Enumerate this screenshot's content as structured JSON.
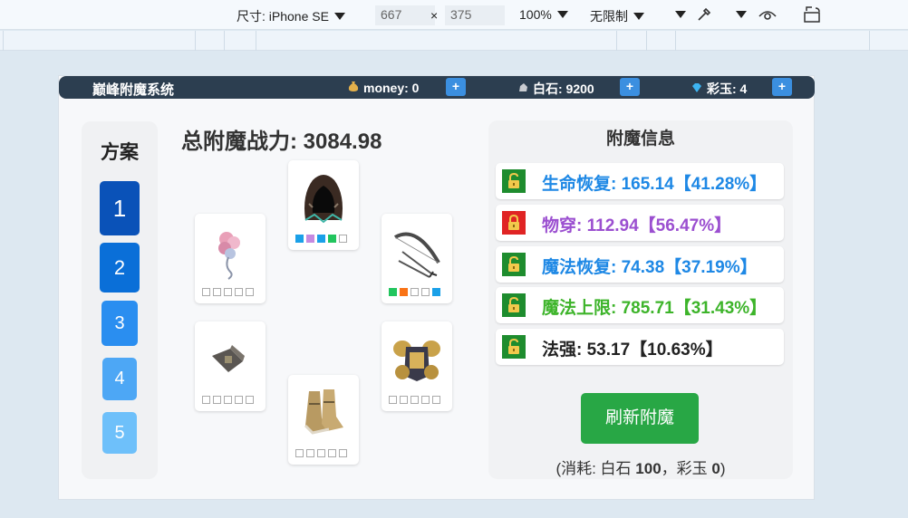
{
  "devtools": {
    "size_label": "尺寸: iPhone SE",
    "width": "667",
    "times": "×",
    "height": "375",
    "zoom": "100%",
    "throttle": "无限制"
  },
  "app": {
    "title": "巅峰附魔系统",
    "money_label": "money: 0",
    "stone_label": "白石: 9200",
    "jade_label": "彩玉: 4",
    "plus": "+"
  },
  "schemes": {
    "title": "方案",
    "items": [
      {
        "label": "1",
        "color": "#0a52b8"
      },
      {
        "label": "2",
        "color": "#0a6fd8"
      },
      {
        "label": "3",
        "color": "#2a8ef0"
      },
      {
        "label": "4",
        "color": "#4da7f5"
      },
      {
        "label": "5",
        "color": "#6ec0fa"
      }
    ]
  },
  "power": "总附魔战力: 3084.98",
  "equipment": {
    "hood": {
      "icon": "hood-icon",
      "gems": [
        "#1aa0e8",
        "#c58ae0",
        "#1aa0e8",
        "#22c55e",
        "#ffffff"
      ]
    },
    "flower": {
      "icon": "flower-icon",
      "gems": [
        "#ffffff",
        "#ffffff",
        "#ffffff",
        "#ffffff",
        "#ffffff"
      ]
    },
    "bow": {
      "icon": "bow-icon",
      "gems": [
        "#22c55e",
        "#f97316",
        "#ffffff",
        "#ffffff",
        "#1aa0e8"
      ]
    },
    "bracer": {
      "icon": "bracer-icon",
      "gems": [
        "#ffffff",
        "#ffffff",
        "#ffffff",
        "#ffffff",
        "#ffffff"
      ]
    },
    "armor": {
      "icon": "armor-icon",
      "gems": [
        "#ffffff",
        "#ffffff",
        "#ffffff",
        "#ffffff",
        "#ffffff"
      ]
    },
    "boots": {
      "icon": "boots-icon",
      "gems": [
        "#ffffff",
        "#ffffff",
        "#ffffff",
        "#ffffff",
        "#ffffff"
      ]
    }
  },
  "info": {
    "title": "附魔信息",
    "rows": [
      {
        "text": "生命恢复: 165.14【41.28%】",
        "color": "#1e88e5",
        "locked": false
      },
      {
        "text": "物穿: 112.94【56.47%】",
        "color": "#9b4fd0",
        "locked": true
      },
      {
        "text": "魔法恢复: 74.38【37.19%】",
        "color": "#1e88e5",
        "locked": false
      },
      {
        "text": "魔法上限: 785.71【31.43%】",
        "color": "#3db42a",
        "locked": false
      },
      {
        "text": "法强: 53.17【10.63%】",
        "color": "#222222",
        "locked": false
      }
    ],
    "refresh_label": "刷新附魔",
    "cost_prefix": "(消耗: 白石 ",
    "cost_stone": "100",
    "cost_mid": "，彩玉 ",
    "cost_jade": "0",
    "cost_suffix": ")"
  }
}
